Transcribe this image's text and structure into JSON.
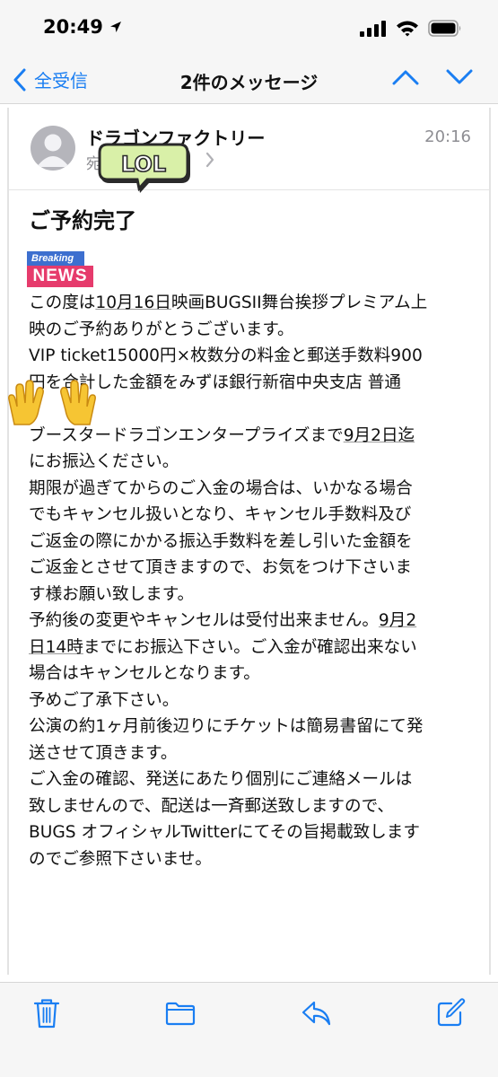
{
  "status_bar": {
    "time": "20:49"
  },
  "nav": {
    "back_label": "全受信",
    "title": "2件のメッセージ"
  },
  "message": {
    "sender": "ドラゴンファクトリー",
    "to_label": "宛",
    "time": "20:16",
    "subject": "ご予約完了",
    "lines": [
      [
        "この度は",
        {
          "u": "10月16日"
        },
        "映画BUGSII舞台挨拶プレミアム上"
      ],
      [
        "映のご予約ありがとうございます。"
      ],
      [
        "VIP ticket15000円×枚数分の料金と郵送手数料900"
      ],
      [
        "円を合計した金額をみずほ銀行新宿中央支店 普通"
      ],
      [
        ""
      ],
      [
        "ブースタードラゴンエンタープライズまで",
        {
          "u": "9月2日迄"
        }
      ],
      [
        "にお振込ください。"
      ],
      [
        "期限が過ぎてからのご入金の場合は、いかなる場合"
      ],
      [
        "でもキャンセル扱いとなり、キャンセル手数料及び"
      ],
      [
        "ご返金の際にかかる振込手数料を差し引いた金額を"
      ],
      [
        "ご返金とさせて頂きますので、お気をつけ下さいま"
      ],
      [
        "す様お願い致します。"
      ],
      [
        "予約後の変更やキャンセルは受付出来ません。",
        {
          "u": "9月2"
        }
      ],
      [
        {
          "u": "日14時"
        },
        "までにお振込下さい。ご入金が確認出来ない"
      ],
      [
        "場合はキャンセルとなります。"
      ],
      [
        "予めご了承下さい。"
      ],
      [
        "公演の約1ヶ月前後辺りにチケットは簡易書留にて発"
      ],
      [
        "送させて頂きます。"
      ],
      [
        "ご入金の確認、発送にあたり個別にご連絡メールは"
      ],
      [
        "致しませんので、配送は一斉郵送致しますので、"
      ],
      [
        "BUGS オフィシャルTwitterにてその旨掲載致します"
      ],
      [
        "のでご参照下さいませ。"
      ]
    ]
  },
  "stickers": {
    "lol": "LOL",
    "breaking": "Breaking",
    "news": "NEWS"
  },
  "toolbar": {
    "icons": [
      "trash-icon",
      "folder-icon",
      "reply-icon",
      "compose-icon"
    ]
  },
  "colors": {
    "accent": "#1a7ef2",
    "bar_bg": "#f6f6f6",
    "secondary_text": "#8e8e93"
  }
}
